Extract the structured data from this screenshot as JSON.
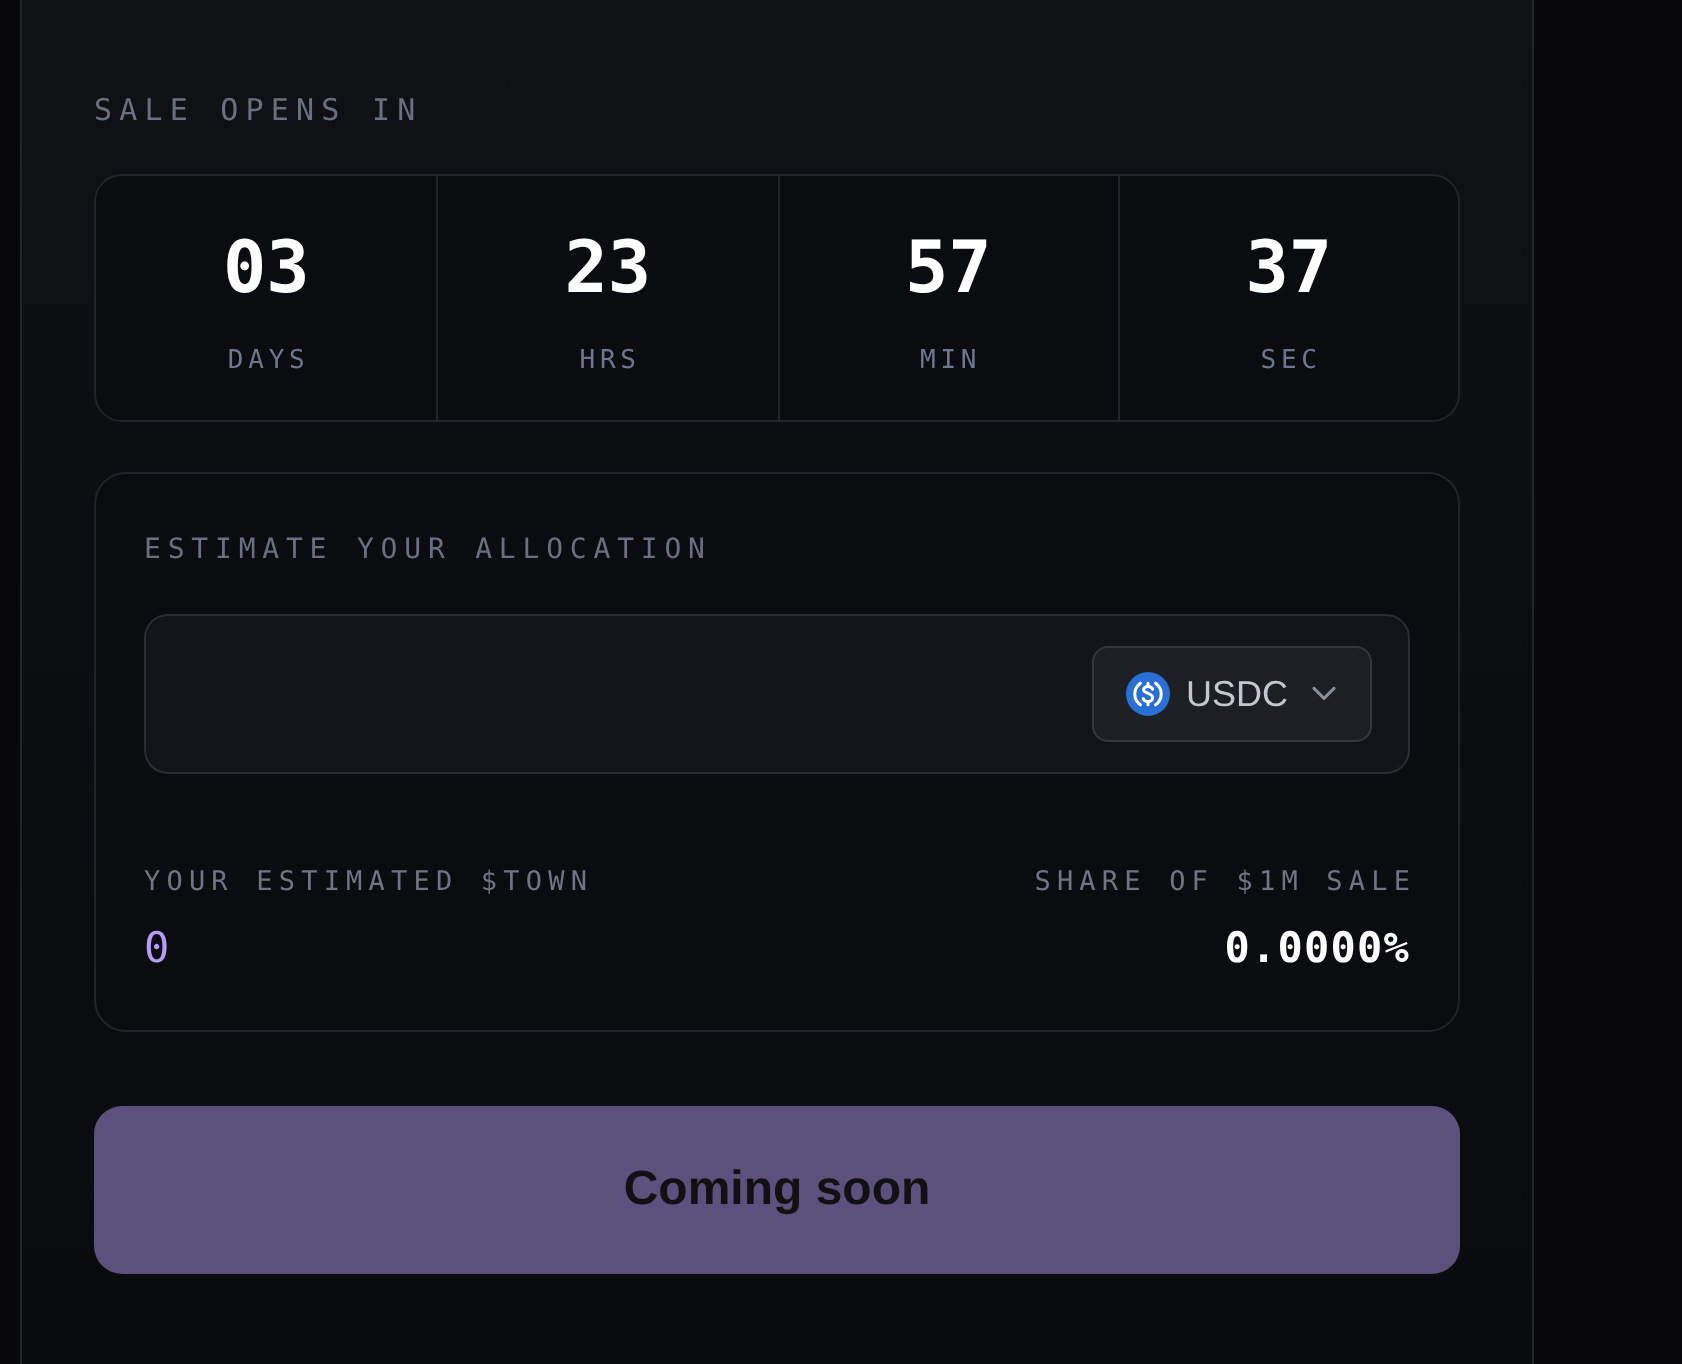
{
  "countdown": {
    "title": "SALE OPENS IN",
    "units": [
      {
        "value": "03",
        "label": "DAYS"
      },
      {
        "value": "23",
        "label": "HRS"
      },
      {
        "value": "57",
        "label": "MIN"
      },
      {
        "value": "37",
        "label": "SEC"
      }
    ]
  },
  "allocation": {
    "title": "ESTIMATE YOUR ALLOCATION",
    "amount_field": {
      "currency": "USDC"
    },
    "estimate": {
      "label": "YOUR ESTIMATED $TOWN",
      "value": "0"
    },
    "share": {
      "label": "SHARE OF $1M SALE",
      "value": "0.0000%"
    }
  },
  "action_button": {
    "label": "Coming soon",
    "disabled": true
  }
}
